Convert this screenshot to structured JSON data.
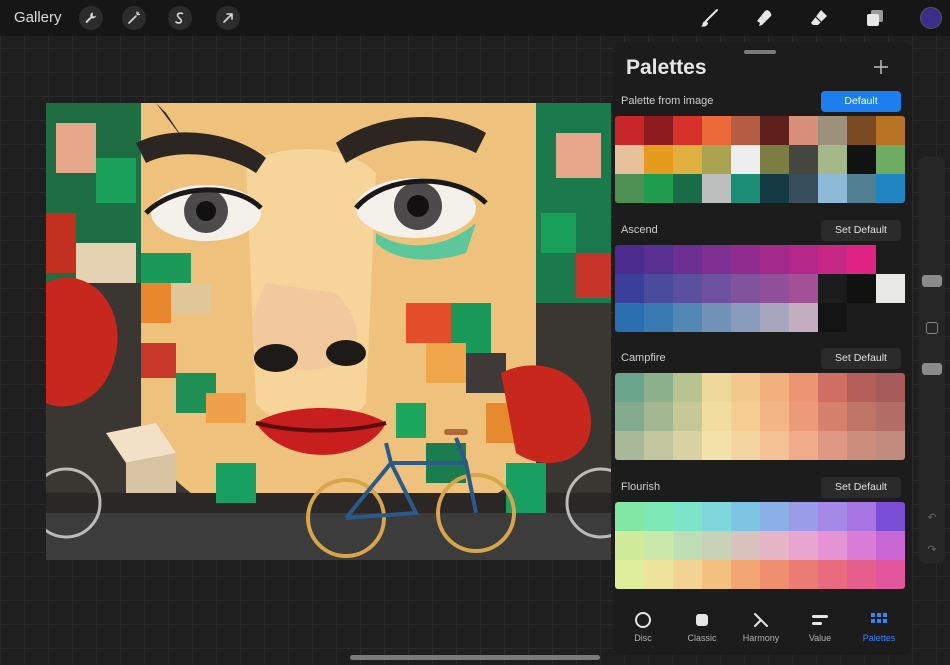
{
  "toolbar": {
    "gallery_label": "Gallery",
    "left_tools": [
      "wrench-icon",
      "magic-wand-icon",
      "selection-icon",
      "transform-arrow-icon"
    ],
    "right_tools": [
      "brush-icon",
      "smudge-icon",
      "eraser-icon",
      "layers-icon"
    ],
    "current_color": "#3b2e8a"
  },
  "panel": {
    "title": "Palettes",
    "palettes": [
      {
        "name": "Palette from image",
        "button": "Default",
        "colors": [
          "#c8272a",
          "#8e1b1d",
          "#d6322b",
          "#ec6a3a",
          "#b45c44",
          "#5e1e1c",
          "#d9907a",
          "#9d917c",
          "#7a4a25",
          "#b87324",
          "#e5c09b",
          "#e69a1e",
          "#dfb03d",
          "#a9a250",
          "#eeeeee",
          "#7c7d42",
          "#45463e",
          "#a4b889",
          "#121212",
          "#6fab62",
          "#4d9254",
          "#1f9c4d",
          "#1a6b47",
          "#bcbfbd",
          "#1a8f76",
          "#143a43",
          "#394e5d",
          "#8fbad7",
          "#4f7f90",
          "#1f85c3"
        ]
      },
      {
        "name": "Ascend",
        "button": "Set Default",
        "colors": [
          "#4c2d8f",
          "#5a2f92",
          "#6c3093",
          "#7d2f92",
          "#902c8f",
          "#a12a8b",
          "#b5288a",
          "#c82885",
          "#e02282",
          "#1c1c1c",
          "#3b3f9c",
          "#4b4b9e",
          "#5b4f9f",
          "#6e529f",
          "#7f549d",
          "#924f9a",
          "#a35096",
          "#1c1c1c",
          "#111111",
          "#e8e8e4",
          "#2a6fb0",
          "#3a7ab3",
          "#5388b5",
          "#7293b8",
          "#8a9cbb",
          "#a6a6bd",
          "#c3aec0",
          "#141414",
          "#1c1c1c",
          "#1c1c1c"
        ]
      },
      {
        "name": "Campfire",
        "button": "Set Default",
        "colors": [
          "#6aa48a",
          "#8db08c",
          "#b7c491",
          "#eed99a",
          "#f3c98e",
          "#f2b07e",
          "#ec9572",
          "#cf6f63",
          "#b45f5a",
          "#a85b5b",
          "#83aa8c",
          "#a3b792",
          "#c6c997",
          "#f1dda0",
          "#f5cd92",
          "#f2b585",
          "#ec9b79",
          "#d6806e",
          "#c07466",
          "#b26e66",
          "#a9b998",
          "#c2c69e",
          "#d9d3a3",
          "#f3e2aa",
          "#f5d59f",
          "#f3c194",
          "#eeac8b",
          "#dd9982",
          "#cc8e7c",
          "#c18b7e"
        ]
      },
      {
        "name": "Flourish",
        "button": "Set Default",
        "colors": [
          "#82e6a5",
          "#7ee8b7",
          "#7de3c9",
          "#7fd7dc",
          "#7ec5e4",
          "#8bb0e8",
          "#9a9ce8",
          "#a489e6",
          "#a874e2",
          "#7a4fd6",
          "#d0ec9a",
          "#c8e9a9",
          "#bedfb5",
          "#c8d2b7",
          "#d9c1bd",
          "#e3b5c5",
          "#e8a5cf",
          "#e493d5",
          "#da7dd8",
          "#c866d4",
          "#dfee9a",
          "#eee39b",
          "#f2d393",
          "#f3c07f",
          "#f2a672",
          "#ee906f",
          "#ea7c73",
          "#e86b7f",
          "#e65e8e",
          "#e3559c"
        ]
      }
    ]
  },
  "tabs": [
    {
      "label": "Disc",
      "icon": "disc-icon",
      "active": false
    },
    {
      "label": "Classic",
      "icon": "classic-icon",
      "active": false
    },
    {
      "label": "Harmony",
      "icon": "harmony-icon",
      "active": false
    },
    {
      "label": "Value",
      "icon": "value-icon",
      "active": false
    },
    {
      "label": "Palettes",
      "icon": "palettes-icon",
      "active": true
    }
  ]
}
